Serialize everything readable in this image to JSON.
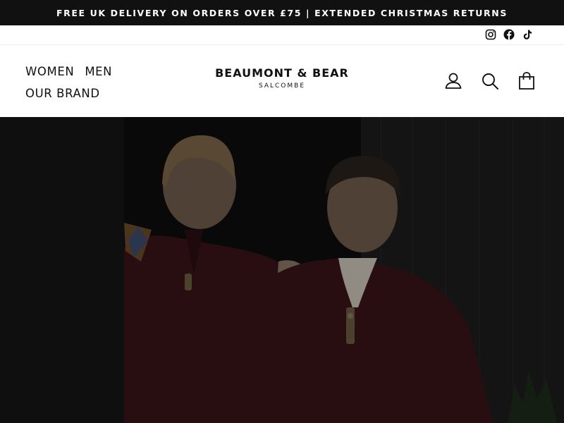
{
  "announcement": {
    "text": "FREE UK DELIVERY ON ORDERS OVER £75 | EXTENDED CHRISTMAS RETURNS"
  },
  "social": {
    "icons": [
      "instagram-icon",
      "facebook-icon",
      "tiktok-icon"
    ]
  },
  "nav": {
    "items": [
      {
        "label": "WOMEN"
      },
      {
        "label": "MEN"
      },
      {
        "label": "OUR BRAND"
      }
    ]
  },
  "brand": {
    "name": "BEAUMONT & BEAR",
    "location": "SALCOMBE"
  },
  "header_icons": [
    "account-icon",
    "search-icon",
    "cart-icon"
  ],
  "hero": {
    "background_color": "#121212",
    "sweater_color": "#3a1418"
  }
}
